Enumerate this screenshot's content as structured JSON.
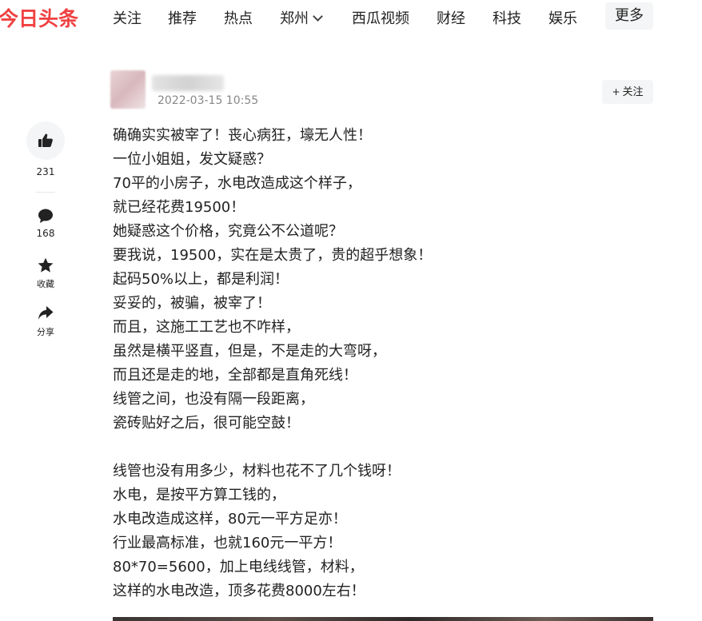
{
  "logo": "今日头条",
  "nav": {
    "items": [
      "关注",
      "推荐",
      "热点",
      "郑州",
      "西瓜视频",
      "财经",
      "科技",
      "娱乐"
    ],
    "more": "更多"
  },
  "author": {
    "time": "2022-03-15 10:55",
    "follow_label": "关注"
  },
  "sidebar": {
    "likes": "231",
    "comments": "168",
    "collect_label": "收藏",
    "share_label": "分享"
  },
  "article": {
    "paragraph1": [
      "确确实实被宰了！丧心病狂，壕无人性！",
      "一位小姐姐，发文疑惑？",
      "70平的小房子，水电改造成这个样子，",
      "就已经花费19500！",
      "她疑惑这个价格，究竟公不公道呢？",
      "要我说，19500，实在是太贵了，贵的超乎想象！",
      "起码50%以上，都是利润！",
      "妥妥的，被骗，被宰了！",
      "而且，这施工工艺也不咋样，",
      "虽然是横平竖直，但是，不是走的大弯呀，",
      "而且还是走的地，全部都是直角死线！",
      "线管之间，也没有隔一段距离，",
      "瓷砖贴好之后，很可能空鼓！"
    ],
    "paragraph2": [
      "线管也没有用多少，材料也花不了几个钱呀！",
      "水电，是按平方算工钱的，",
      "水电改造成这样，80元一平方足亦！",
      "行业最高标准，也就160元一平方！",
      "80*70=5600，加上电线线管，材料，",
      "这样的水电改造，顶多花费8000左右！"
    ]
  }
}
